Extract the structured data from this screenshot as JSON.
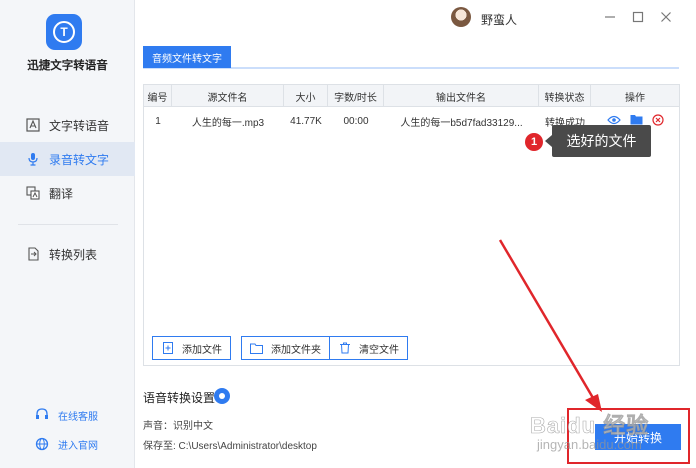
{
  "app": {
    "name": "迅捷文字转语音"
  },
  "sidebar": {
    "items": [
      {
        "label": "文字转语音",
        "icon": "text-to-speech-icon"
      },
      {
        "label": "录音转文字",
        "icon": "microphone-icon",
        "active": true
      },
      {
        "label": "翻译",
        "icon": "translate-icon"
      },
      {
        "label": "转换列表",
        "icon": "convert-list-icon"
      }
    ],
    "footer": [
      {
        "label": "在线客服",
        "icon": "headset-icon"
      },
      {
        "label": "进入官网",
        "icon": "globe-icon"
      }
    ]
  },
  "titlebar": {
    "username": "野蛮人"
  },
  "tab": {
    "label": "音频文件转文字"
  },
  "table": {
    "headers": [
      "编号",
      "源文件名",
      "大小",
      "字数/时长",
      "输出文件名",
      "转换状态",
      "操作"
    ],
    "rows": [
      {
        "index": "1",
        "source": "人生的每一.mp3",
        "size": "41.77K",
        "duration": "00:00",
        "output": "人生的每一b5d7fad33129...",
        "status": "转换成功"
      }
    ]
  },
  "buttons": {
    "add_file": "添加文件",
    "add_folder": "添加文件夹",
    "clear": "清空文件",
    "start": "开始转换"
  },
  "settings": {
    "title": "语音转换设置",
    "voice": "声音：识别中文",
    "save_to": "保存至: C:\\Users\\Administrator\\desktop"
  },
  "annotation": {
    "number": "1",
    "text": "选好的文件"
  },
  "watermark": {
    "line1": "Baidu 经验",
    "line2": "jingyan.baidu.com"
  },
  "colors": {
    "accent": "#2f7bf0",
    "annotation_red": "#e0262b"
  }
}
